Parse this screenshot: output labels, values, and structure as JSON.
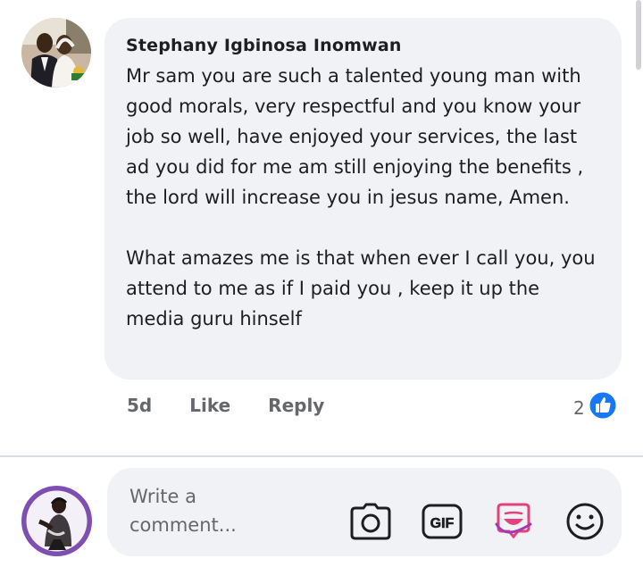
{
  "comment": {
    "author": "Stephany Igbinosa Inomwan",
    "paragraphs": [
      "Mr sam you are such a talented young man with good morals, very respectful and you know your job so well, have enjoyed your services, the last ad you did for me am still enjoying the benefits , the lord will increase you in jesus name, Amen.",
      "What amazes me is that when ever I call you, you attend to me as if I paid you , keep it up the media guru hinself"
    ],
    "timestamp": "5d",
    "like_label": "Like",
    "reply_label": "Reply",
    "reaction_count": "2",
    "reaction_icon": "thumbs-up-icon",
    "reaction_color": "#1877f2"
  },
  "composer": {
    "placeholder": "Write a comment...",
    "icons": [
      "camera-icon",
      "gif-icon",
      "avatar-sticker-icon",
      "emoji-icon"
    ],
    "sticker_color": "#e4427d"
  }
}
